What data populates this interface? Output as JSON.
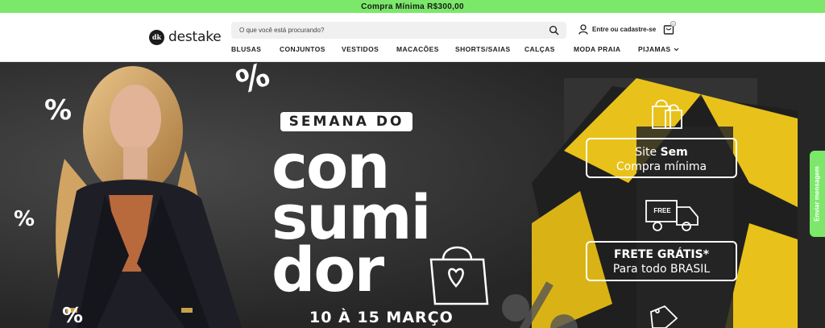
{
  "topbar": {
    "text": "Compra Mínima R$300,00"
  },
  "header": {
    "logo_text": "destake",
    "logo_mark": "dk",
    "search": {
      "placeholder": "O que você está procurando?"
    },
    "account_label": "Entre ou cadastre-se",
    "cart_count": "0"
  },
  "nav": {
    "items": [
      "BLUSAS",
      "CONJUNTOS",
      "VESTIDOS",
      "MACACÕES",
      "SHORTS/SAIAS",
      "CALÇAS",
      "MODA PRAIA",
      "PIJAMAS"
    ]
  },
  "hero": {
    "badge": "SEMANA DO",
    "word1": "con",
    "word2": "sumi",
    "word3": "dor",
    "date": "10 À 15 MARÇO",
    "box1_line1_a": "Site ",
    "box1_line1_b": "Sem",
    "box1_line2": "Compra mínima",
    "truck_label": "FREE",
    "box2_line1": "FRETE GRÁTIS*",
    "box2_line2": "Para todo BRASIL",
    "percent_symbol": "%"
  },
  "chat": {
    "label": "Enviar mensagem"
  },
  "colors": {
    "accent_green": "#7be86a",
    "hero_dark": "#2a2a2a",
    "gift_yellow": "#e8c21a"
  }
}
